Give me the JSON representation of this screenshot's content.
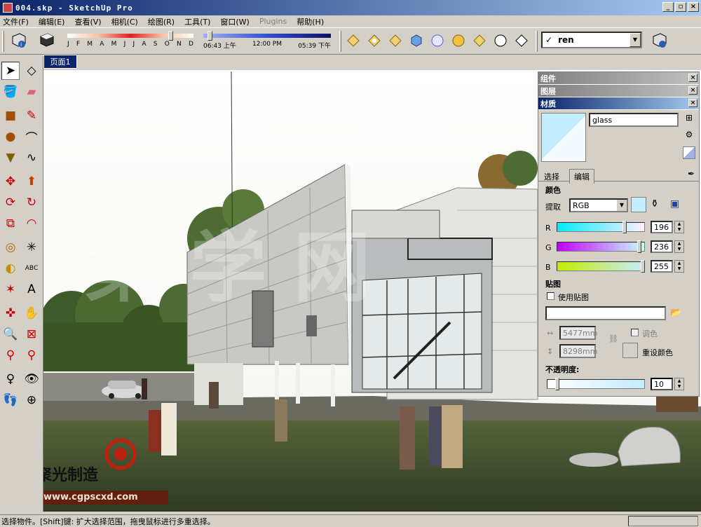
{
  "window": {
    "title": "004.skp - SketchUp Pro",
    "min": "_",
    "restore": "▫",
    "close": "×"
  },
  "menu": [
    "文件(F)",
    "编辑(E)",
    "查看(V)",
    "相机(C)",
    "绘图(R)",
    "工具(T)",
    "窗口(W)",
    "Plugins",
    "帮助(H)"
  ],
  "shadow": {
    "months": [
      "J",
      "F",
      "M",
      "A",
      "M",
      "J",
      "J",
      "A",
      "S",
      "O",
      "N",
      "D"
    ],
    "time_start": "06:43 上午",
    "time_mid": "12:00 PM",
    "time_end": "05:39 下午"
  },
  "scene": {
    "selected": "ren",
    "check": "✓"
  },
  "page_tab": "页面1",
  "panels": {
    "components": "组件",
    "layers": "图层",
    "materials": "材质"
  },
  "material": {
    "name": "glass",
    "tabs": [
      "选择",
      "编辑"
    ],
    "color_section": "颜色",
    "pick_label": "提取",
    "color_mode": "RGB",
    "r_label": "R",
    "g_label": "G",
    "b_label": "B",
    "r_value": "196",
    "g_value": "236",
    "b_value": "255",
    "texture_section": "贴图",
    "use_texture": "使用贴图",
    "width": "5477mm",
    "height": "8298mm",
    "colorize": "调色",
    "reset_color": "重设颜色",
    "opacity_label": "不透明度:",
    "opacity_value": "10",
    "swatch": "#c4ecff"
  },
  "watermark": {
    "brand": "聚光制造",
    "url": "www.cgpscxd.com"
  },
  "status": "选择物件。[Shift]键: 扩大选择范围，拖曳鼠标进行多重选择。"
}
